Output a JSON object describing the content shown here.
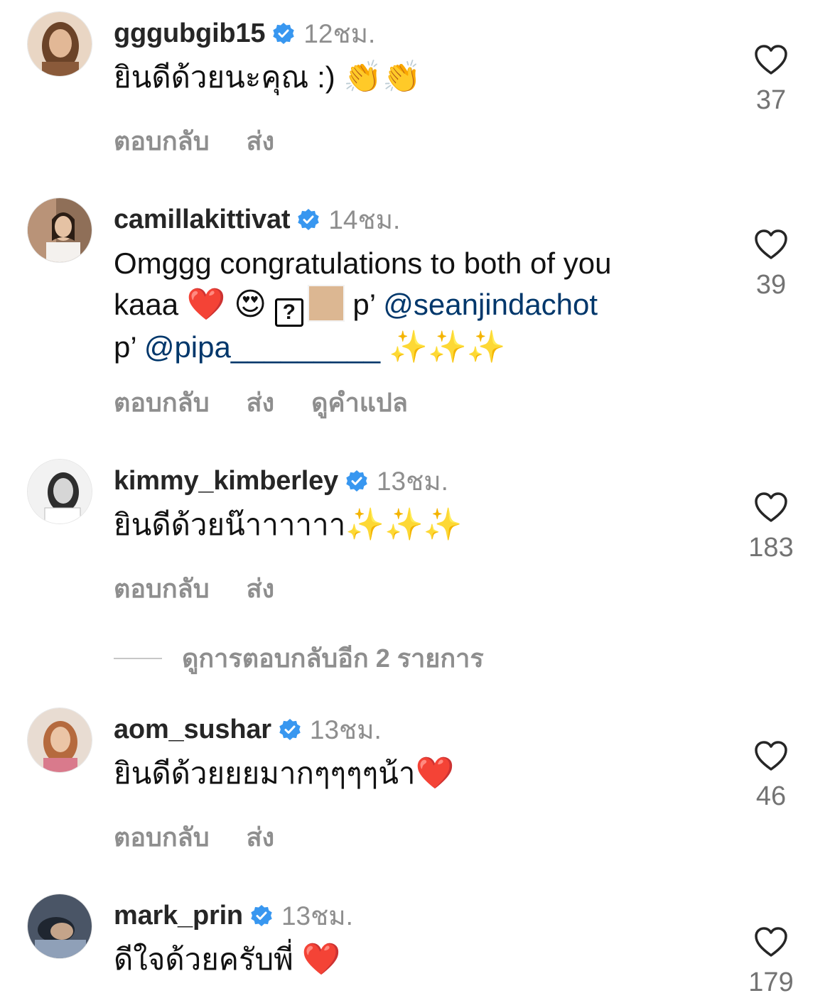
{
  "comments": [
    {
      "username": "gggubgib15",
      "time": "12ชม.",
      "text": "ยินดีด้วยนะคุณ :) ",
      "emojis": "👏👏",
      "actions": [
        "ตอบกลับ",
        "ส่ง"
      ],
      "likes": "37",
      "avatar_colors": [
        "#c9a07a",
        "#5b3a24"
      ]
    },
    {
      "username": "camillakittivat",
      "time": "14ชม.",
      "text_parts": {
        "line1": "Omggg congratulations to both of you",
        "kaaa": "kaaa ",
        "heart": "❤️",
        "heart_eyes": "😍",
        "qmark": "?",
        "p1": " p’ ",
        "mention1": "@seanjindachot",
        "p2": "p’ ",
        "mention2": "@pipa_________",
        "sparkles": " ✨✨✨"
      },
      "actions": [
        "ตอบกลับ",
        "ส่ง",
        "ดูคำแปล"
      ],
      "likes": "39",
      "avatar_colors": [
        "#b98a6a",
        "#2b1d14"
      ]
    },
    {
      "username": "kimmy_kimberley",
      "time": "13ชม.",
      "text": "ยินดีด้วยน๊าาาาาา",
      "emojis": "✨✨✨",
      "actions": [
        "ตอบกลับ",
        "ส่ง"
      ],
      "likes": "183",
      "avatar_colors": [
        "#d9d9d9",
        "#3a3a3a"
      ]
    },
    {
      "username": "aom_sushar",
      "time": "13ชม.",
      "text": "ยินดีด้วยยยมากๆๆๆๆน้า",
      "emojis": "❤️",
      "actions": [
        "ตอบกลับ",
        "ส่ง"
      ],
      "likes": "46",
      "avatar_colors": [
        "#d8a98a",
        "#c77a8a"
      ]
    },
    {
      "username": "mark_prin",
      "time": "13ชม.",
      "text": "ดีใจด้วยครับพี่ ",
      "emojis": "❤️",
      "actions": [],
      "likes": "179",
      "avatar_colors": [
        "#6f7f94",
        "#2a3340"
      ]
    }
  ],
  "view_replies": "ดูการตอบกลับอีก 2 รายการ",
  "colors": {
    "verified": "#3897f0",
    "mention": "#00376b",
    "secondary": "#8e8e8e"
  },
  "icons": {
    "verified": "verified-badge-icon",
    "like": "heart-outline-icon"
  }
}
